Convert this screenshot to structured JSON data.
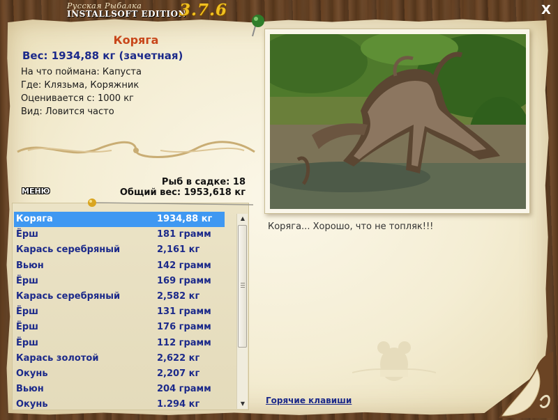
{
  "window": {
    "logo_line1": "Русская Рыбалка",
    "logo_line2": "INSTALLSOFT EDITION",
    "version": "3.7.6",
    "close_label": "X"
  },
  "fish": {
    "name": "Коряга",
    "weight": "Вес: 1934,88 кг (зачетная)",
    "bait": "На что поймана: Капуста",
    "location": "Где: Клязьма, Коряжник",
    "valued_from": "Оценивается с: 1000 кг",
    "frequency": "Вид: Ловится часто"
  },
  "stats": {
    "fish_in_cage": "Рыб в садке: 18",
    "total_weight": "Общий вес: 1953,618 кг"
  },
  "menu_label": "МЕНЮ",
  "catch_list": [
    {
      "name": "Коряга",
      "weight": "1934,88 кг",
      "selected": true
    },
    {
      "name": "Ёрш",
      "weight": "181 грамм"
    },
    {
      "name": "Карась серебряный",
      "weight": "2,161 кг"
    },
    {
      "name": "Вьюн",
      "weight": "142 грамм"
    },
    {
      "name": "Ёрш",
      "weight": "169 грамм"
    },
    {
      "name": "Карась серебряный",
      "weight": "2,582 кг"
    },
    {
      "name": "Ёрш",
      "weight": "131 грамм"
    },
    {
      "name": "Ёрш",
      "weight": "176 грамм"
    },
    {
      "name": "Ёрш",
      "weight": "112 грамм"
    },
    {
      "name": "Карась золотой",
      "weight": "2,622 кг"
    },
    {
      "name": "Окунь",
      "weight": "2,207 кг"
    },
    {
      "name": "Вьюн",
      "weight": "204 грамм"
    },
    {
      "name": "Окунь",
      "weight": "1.294 кг"
    }
  ],
  "scrollbar": {
    "up_icon": "arrow-up-icon",
    "down_icon": "arrow-down-icon"
  },
  "caption": "Коряга... Хорошо, что не топляк!!!",
  "hotkeys_label": "Горячие клавиши",
  "colors": {
    "title_orange": "#c8461a",
    "label_blue": "#1c2a8a",
    "selection_blue": "#3f98f2",
    "version_gold": "#f0c020",
    "paper": "#f4edd3",
    "wood": "#5b3a1d"
  }
}
